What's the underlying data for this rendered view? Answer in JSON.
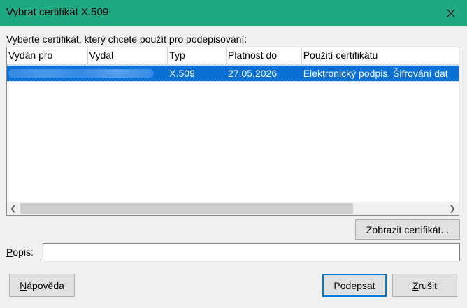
{
  "window": {
    "title": "Vybrat certifikát X.509"
  },
  "instruction": "Vyberte certifikát, který chcete použít pro podepisování:",
  "table": {
    "columns": [
      "Vydán pro",
      "Vydal",
      "Typ",
      "Platnost do",
      "Použití certifikátu"
    ],
    "rows": [
      {
        "issued_to": "",
        "issuer": "",
        "type": "X.509",
        "expires": "27.05.2026",
        "usage": "Elektronický podpis, Šifrování dat"
      }
    ]
  },
  "buttons": {
    "view_certificate": "Zobrazit certifikát...",
    "help": "Nápověda",
    "sign": "Podepsat",
    "cancel": "Zrušit"
  },
  "description": {
    "label": "Popis:",
    "value": ""
  }
}
